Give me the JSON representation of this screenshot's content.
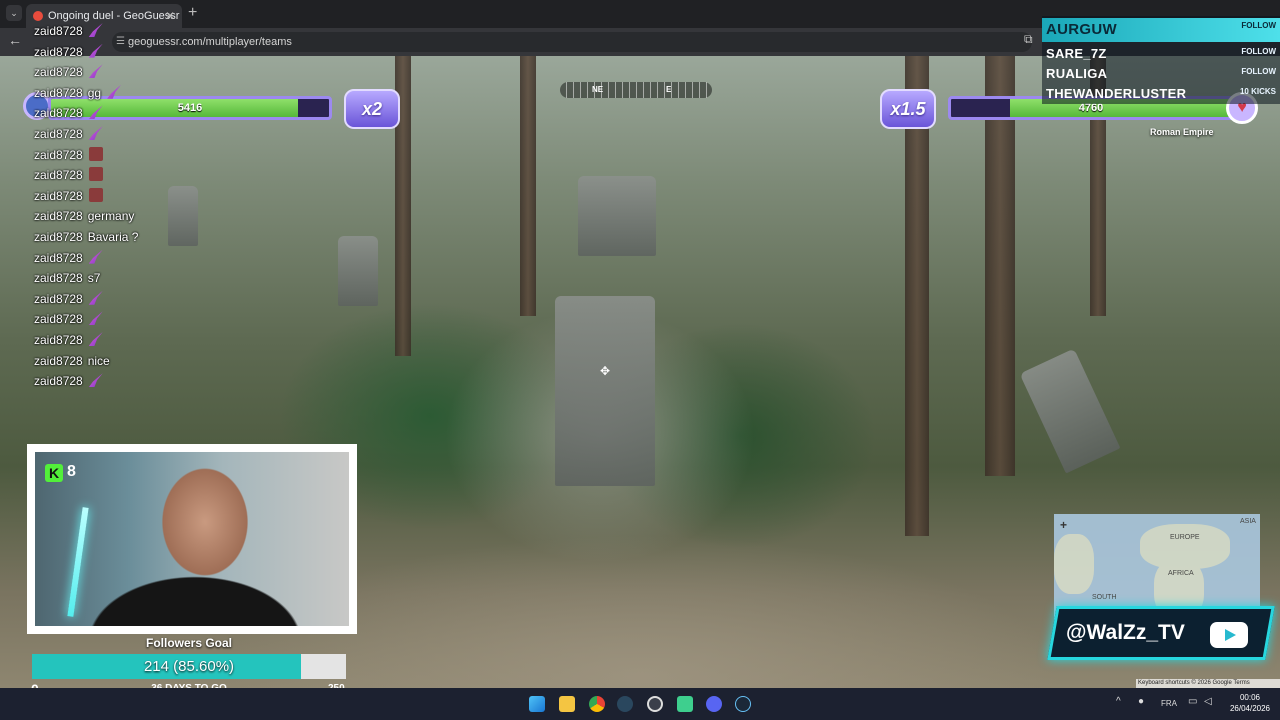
{
  "browser": {
    "tab_title": "Ongoing duel - GeoGuessr",
    "tab_close": "✕",
    "new_tab": "+",
    "url": "geoguessr.com/multiplayer/teams",
    "back": "←"
  },
  "hud": {
    "left_health": "5416",
    "left_multiplier": "x2",
    "right_health": "4760",
    "right_multiplier": "x1.5",
    "compass_ne": "NE",
    "compass_e": "E",
    "opponent_name": "Roman Empire"
  },
  "social_list": [
    {
      "name": "AURGUW",
      "tag": "FOLLOW"
    },
    {
      "name": "SARE_7Z",
      "tag": "FOLLOW"
    },
    {
      "name": "RUALIGA",
      "tag": "FOLLOW"
    },
    {
      "name": "THEWANDERLUSTER",
      "tag": "10 KICKS"
    }
  ],
  "chat": [
    {
      "user": "zaid8728",
      "text": "",
      "emote": "feather"
    },
    {
      "user": "zaid8728",
      "text": "",
      "emote": "feather"
    },
    {
      "user": "zaid8728",
      "text": "",
      "emote": "feather"
    },
    {
      "user": "zaid8728",
      "text": "gg",
      "emote": "feather"
    },
    {
      "user": "zaid8728",
      "text": "",
      "emote": "feather"
    },
    {
      "user": "zaid8728",
      "text": "",
      "emote": "feather"
    },
    {
      "user": "zaid8728",
      "text": "",
      "emote": "box"
    },
    {
      "user": "zaid8728",
      "text": "",
      "emote": "box"
    },
    {
      "user": "zaid8728",
      "text": "",
      "emote": "box"
    },
    {
      "user": "zaid8728",
      "text": "germany",
      "emote": ""
    },
    {
      "user": "zaid8728",
      "text": "Bavaria ?",
      "emote": ""
    },
    {
      "user": "zaid8728",
      "text": "",
      "emote": "feather"
    },
    {
      "user": "zaid8728",
      "text": "s7",
      "emote": ""
    },
    {
      "user": "zaid8728",
      "text": "",
      "emote": "feather"
    },
    {
      "user": "zaid8728",
      "text": "",
      "emote": "feather"
    },
    {
      "user": "zaid8728",
      "text": "",
      "emote": "feather"
    },
    {
      "user": "zaid8728",
      "text": "nice",
      "emote": ""
    },
    {
      "user": "zaid8728",
      "text": "",
      "emote": "feather"
    }
  ],
  "webcam": {
    "kick_logo": "K",
    "kick_count": "8"
  },
  "followers_goal": {
    "title": "Followers Goal",
    "progress_text": "214 (85.60%)",
    "progress": 0.856,
    "min": "0",
    "max": "250",
    "days_left": "36 DAYS TO GO"
  },
  "minimap": {
    "labels": [
      "EUROPE",
      "ASIA",
      "AFRICA",
      "SOUTH"
    ],
    "zoom": "+"
  },
  "map_footer": "Keyboard shortcuts  © 2026 Google  Terms",
  "handle": "@WalZz_TV",
  "taskbar": {
    "language": "FRA",
    "time": "00:06",
    "date": "26/04/2026"
  },
  "colors": {
    "accent": "#27d7df",
    "hud_purple": "#9c89f0",
    "health_green": "#56b83a",
    "goal_fill": "#24c4bd"
  }
}
